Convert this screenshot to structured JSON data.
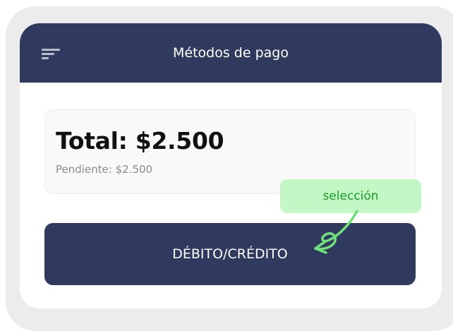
{
  "header": {
    "title": "Métodos de pago",
    "menu_icon": "menu-icon"
  },
  "total_card": {
    "total": "Total: $2.500",
    "pending": "Pendiente: $2.500"
  },
  "payment_button": {
    "label": "DÉBITO/CRÉDITO"
  },
  "annotation": {
    "label": "selección",
    "arrow_icon": "curly-arrow-icon"
  },
  "colors": {
    "primary": "#2f3a5e",
    "annotation_bg": "#c3f7c5",
    "annotation_text": "#1a9a24"
  }
}
